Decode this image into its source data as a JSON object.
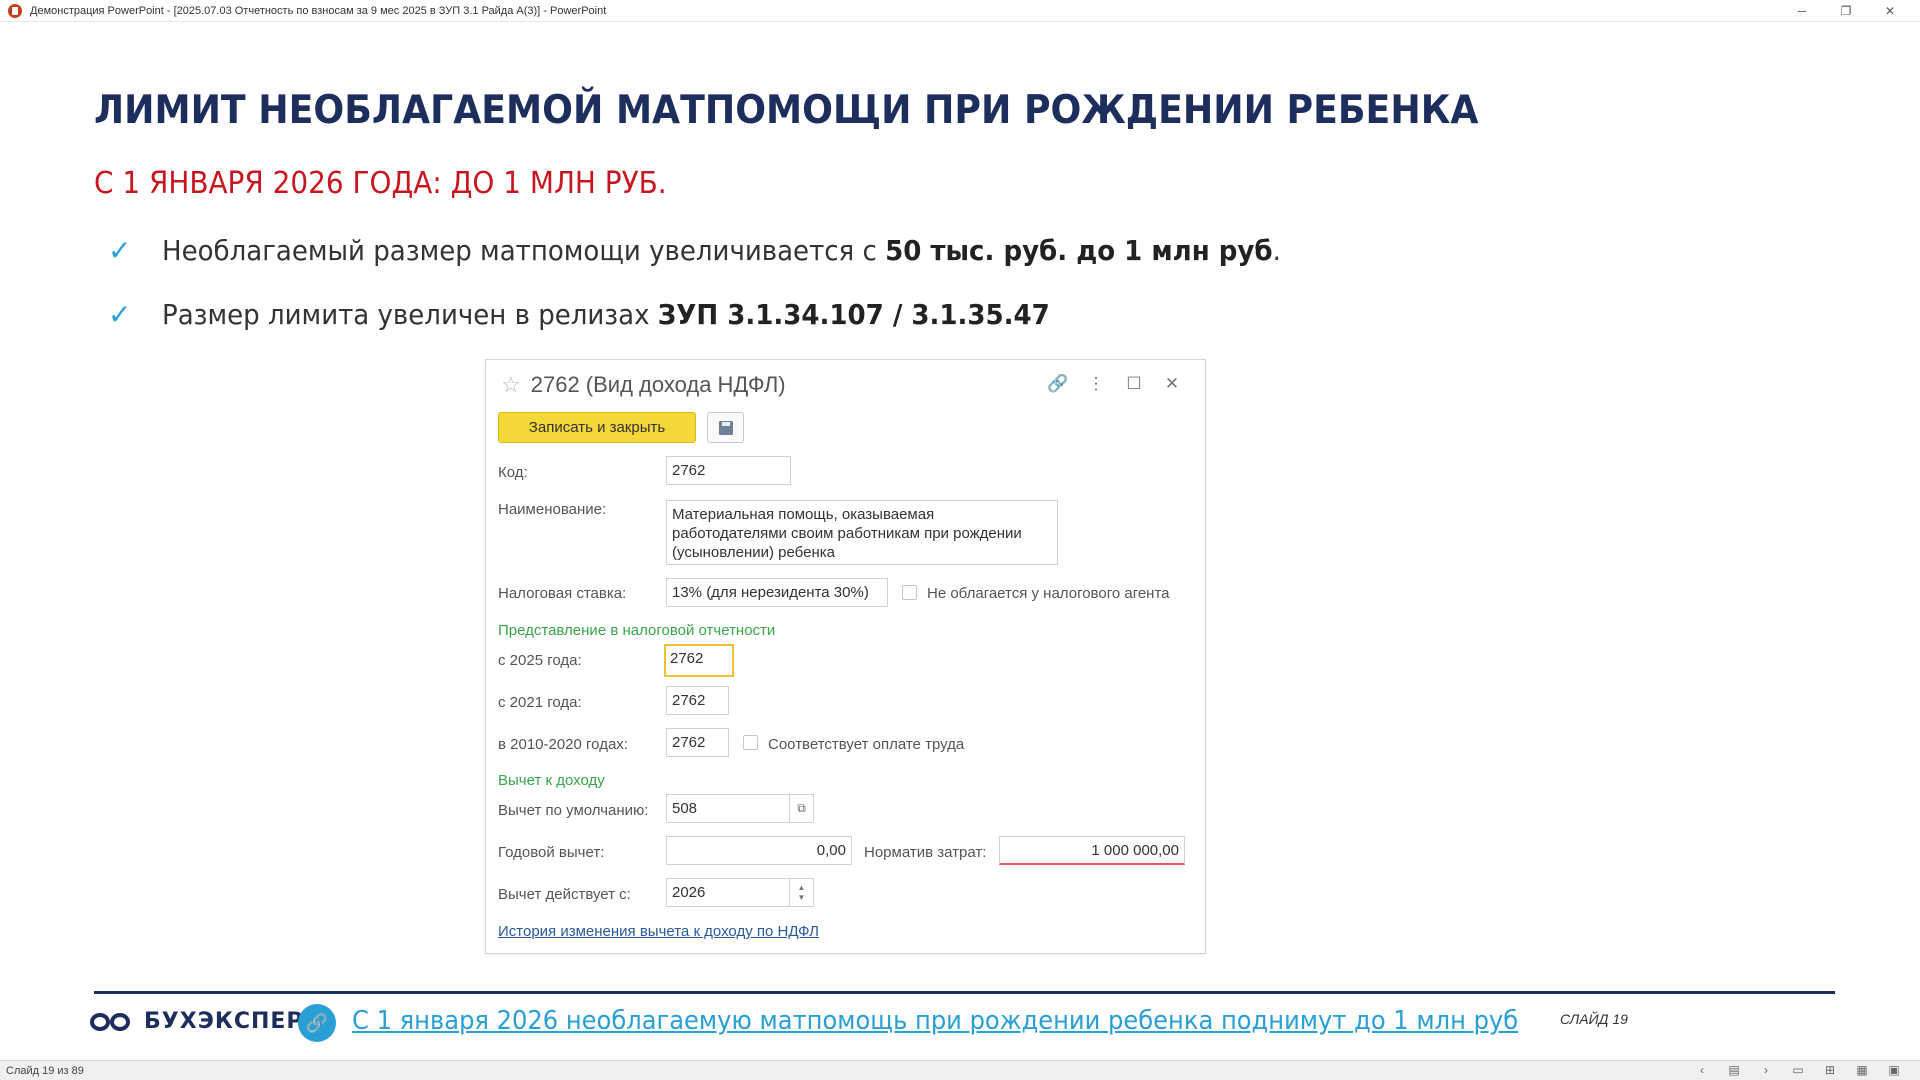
{
  "window": {
    "title": "Демонстрация PowerPoint - [2025.07.03 Отчетность по взносам за 9 мес  2025 в ЗУП 3.1 Райда А(3)] - PowerPoint",
    "minimize": "─",
    "restore": "❐",
    "close": "✕"
  },
  "slide": {
    "title": "ЛИМИТ НЕОБЛАГАЕМОЙ МАТПОМОЩИ ПРИ РОЖДЕНИИ РЕБЕНКА",
    "subtitle": "С 1 ЯНВАРЯ 2026 ГОДА: ДО 1 МЛН РУБ.",
    "check": "✓",
    "bullets": [
      {
        "text": "Необлагаемый размер матпомощи увеличивается с ",
        "bold": "50 тыс. руб. до 1 млн руб",
        "tail": "."
      },
      {
        "text": "Размер лимита увеличен в релизах ",
        "bold": "ЗУП 3.1.34.107 / 3.1.35.47",
        "tail": ""
      }
    ]
  },
  "form": {
    "star": "☆",
    "title": "2762 (Вид дохода НДФЛ)",
    "icons": {
      "link": "🔗",
      "more": "⋮",
      "maximize": "☐",
      "close": "✕"
    },
    "save_close": "Записать и закрыть",
    "labels": {
      "code": "Код:",
      "name": "Наименование:",
      "tax_rate": "Налоговая ставка:",
      "not_taxed": "Не облагается у налогового агента",
      "section_report": "Представление в налоговой отчетности",
      "from_2025": "с 2025 года:",
      "from_2021": "с 2021 года:",
      "in_2010_2020": "в 2010-2020 годах:",
      "labor_pay": "Соответствует оплате труда",
      "section_deduction": "Вычет к доходу",
      "default_deduction": "Вычет по умолчанию:",
      "annual_deduction": "Годовой вычет:",
      "cost_norm": "Норматив затрат:",
      "effective_from": "Вычет действует с:"
    },
    "values": {
      "code": "2762",
      "name": "Материальная помощь, оказываемая работодателями своим работникам при рождении (усыновлении) ребенка",
      "tax_rate": "13% (для нерезидента 30%)",
      "from_2025": "2762",
      "from_2021": "2762",
      "in_2010_2020": "2762",
      "default_deduction": "508",
      "annual_deduction": "0,00",
      "cost_norm": "1 000 000,00",
      "effective_from": "2026"
    },
    "open_icon": "⧉",
    "spin_up": "▲",
    "spin_down": "▼",
    "history_link": "История изменения вычета к доходу по НДФЛ"
  },
  "footer": {
    "brand": "БУХЭКСПЕРТ",
    "link_icon": "🔗",
    "link_text": "С 1 января 2026 необлагаемую матпомощь при рождении ребенка поднимут до 1 млн руб",
    "slide_label": "СЛАЙД 19"
  },
  "statusbar": {
    "slide_counter": "Слайд 19 из 89",
    "icons": [
      "‹",
      "▤",
      "›",
      "▭",
      "⊞",
      "▦",
      "▣"
    ]
  }
}
